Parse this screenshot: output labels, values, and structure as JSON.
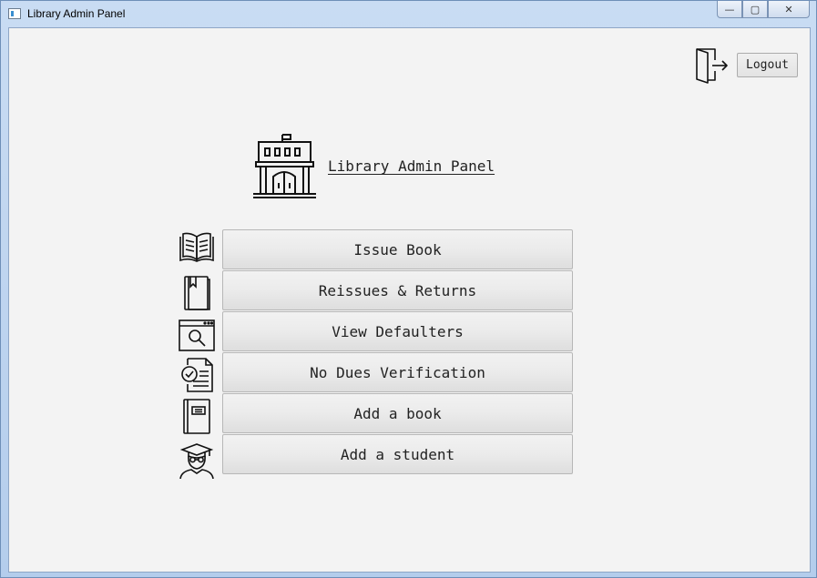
{
  "window": {
    "title": "Library Admin Panel",
    "controls": {
      "minimize": "—",
      "maximize": "▢",
      "close": "✕"
    }
  },
  "header": {
    "title": "Library Admin Panel",
    "icon": "library-building-icon"
  },
  "logout": {
    "label": "Logout",
    "icon": "exit-door-icon"
  },
  "menu": [
    {
      "label": "Issue Book",
      "icon": "open-book-icon"
    },
    {
      "label": "Reissues & Returns",
      "icon": "bookmarked-book-icon"
    },
    {
      "label": "View Defaulters",
      "icon": "search-browser-icon"
    },
    {
      "label": "No Dues Verification",
      "icon": "checked-document-icon"
    },
    {
      "label": "Add a book",
      "icon": "notebook-icon"
    },
    {
      "label": "Add a student",
      "icon": "graduate-student-icon"
    }
  ]
}
